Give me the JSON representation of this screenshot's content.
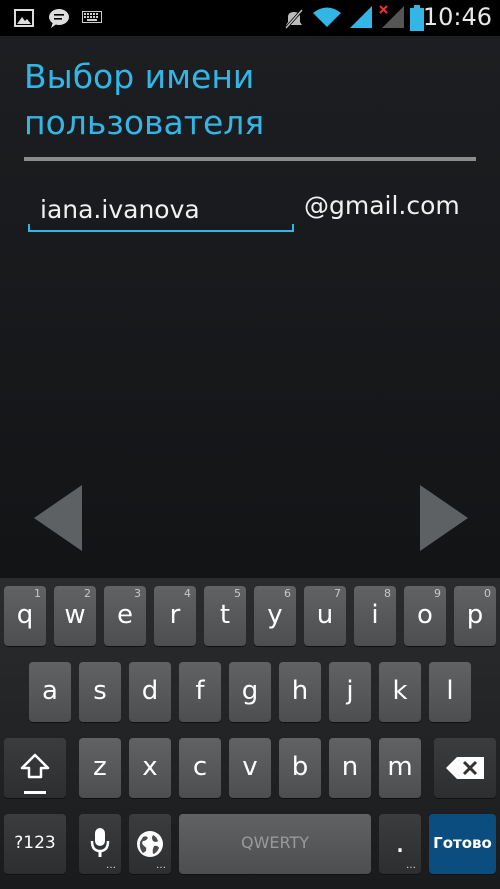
{
  "status_bar": {
    "time": "10:46",
    "left_icons": [
      "gallery-icon",
      "chat-icon",
      "keyboard-icon"
    ],
    "right_icons": [
      "mute-icon",
      "wifi-icon",
      "signal-icon",
      "no-signal-icon",
      "battery-icon"
    ]
  },
  "screen": {
    "title": "Выбор имени\nпользователя",
    "username_value": "iana.ivanova",
    "domain": "@gmail.com"
  },
  "nav": {
    "back": "back-arrow-icon",
    "next": "next-arrow-icon"
  },
  "keyboard": {
    "row1": [
      {
        "label": "q",
        "hint": "1"
      },
      {
        "label": "w",
        "hint": "2"
      },
      {
        "label": "e",
        "hint": "3"
      },
      {
        "label": "r",
        "hint": "4"
      },
      {
        "label": "t",
        "hint": "5"
      },
      {
        "label": "y",
        "hint": "6"
      },
      {
        "label": "u",
        "hint": "7"
      },
      {
        "label": "i",
        "hint": "8"
      },
      {
        "label": "o",
        "hint": "9"
      },
      {
        "label": "p",
        "hint": "0"
      }
    ],
    "row2": [
      "a",
      "s",
      "d",
      "f",
      "g",
      "h",
      "j",
      "k",
      "l"
    ],
    "row3": [
      "z",
      "x",
      "c",
      "v",
      "b",
      "n",
      "m"
    ],
    "symbols_label": "?123",
    "space_label": "QWERTY",
    "period_label": ".",
    "done_label": "Готово"
  }
}
